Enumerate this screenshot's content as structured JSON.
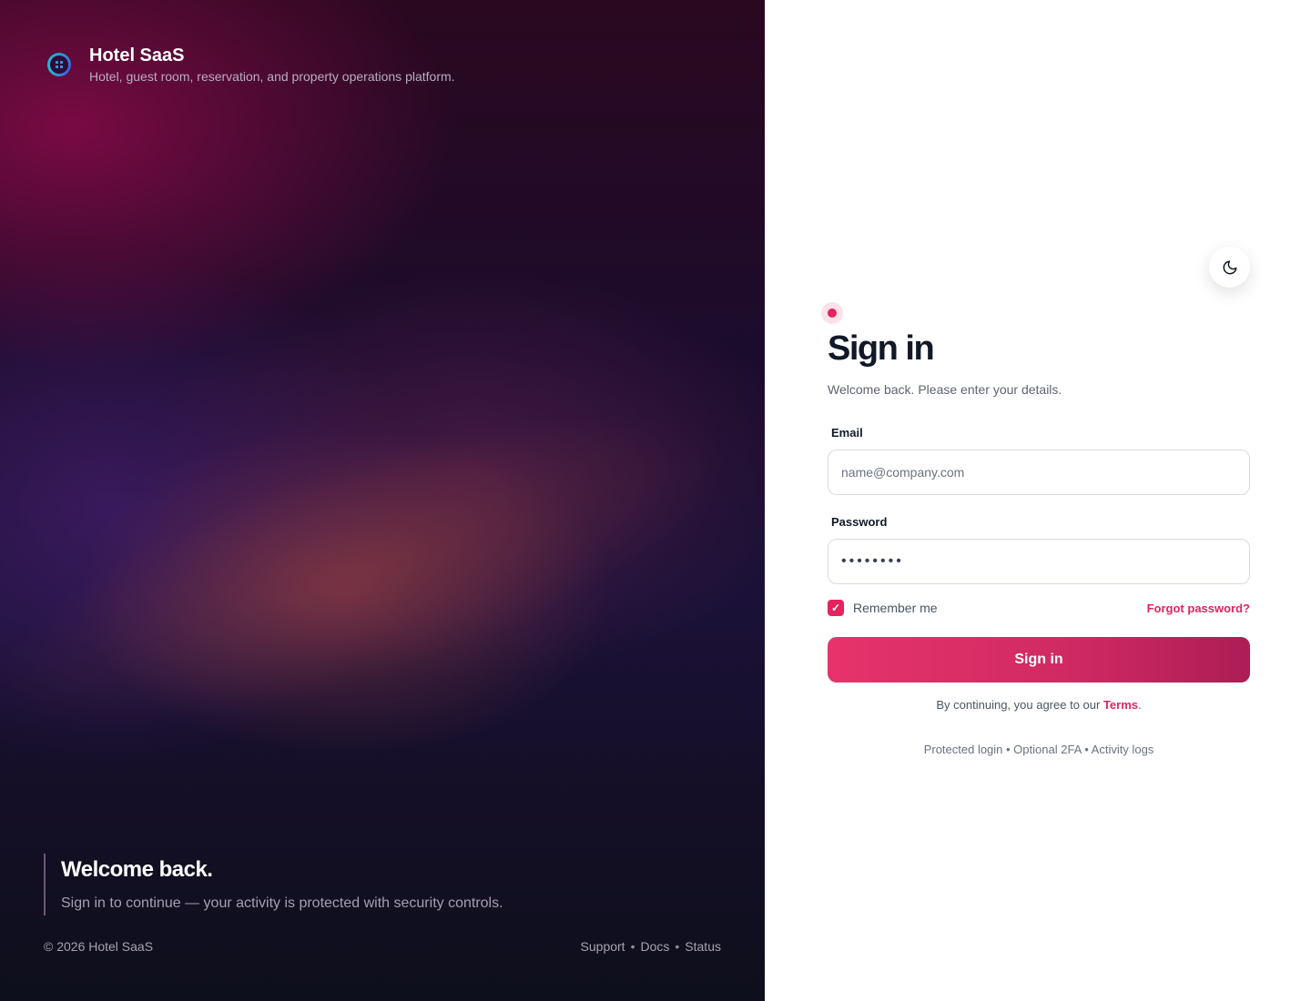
{
  "brand": {
    "title": "Hotel SaaS",
    "tagline": "Hotel, guest room, reservation, and property operations platform.",
    "logo_icon": "grid-icon"
  },
  "hero": {
    "heading": "Welcome back.",
    "subheading": "Sign in to continue — your activity is protected with security controls."
  },
  "footer": {
    "copyright": "© 2026 Hotel SaaS",
    "links": [
      "Support",
      "Docs",
      "Status"
    ],
    "separator": "•"
  },
  "theme_toggle": {
    "icon": "moon-icon"
  },
  "form": {
    "title": "Sign in",
    "subtitle": "Welcome back. Please enter your details.",
    "email": {
      "label": "Email",
      "placeholder": "name@company.com",
      "value": ""
    },
    "password": {
      "label": "Password",
      "value": "••••••••"
    },
    "remember_label": "Remember me",
    "remember_checked": true,
    "forgot_label": "Forgot password?",
    "submit_label": "Sign in",
    "terms_prefix": "By continuing, you agree to our ",
    "terms_link": "Terms",
    "terms_suffix": ".",
    "security_note": "Protected login • Optional 2FA • Activity logs"
  },
  "colors": {
    "accent": "#e3245f",
    "text_dark": "#111827"
  }
}
